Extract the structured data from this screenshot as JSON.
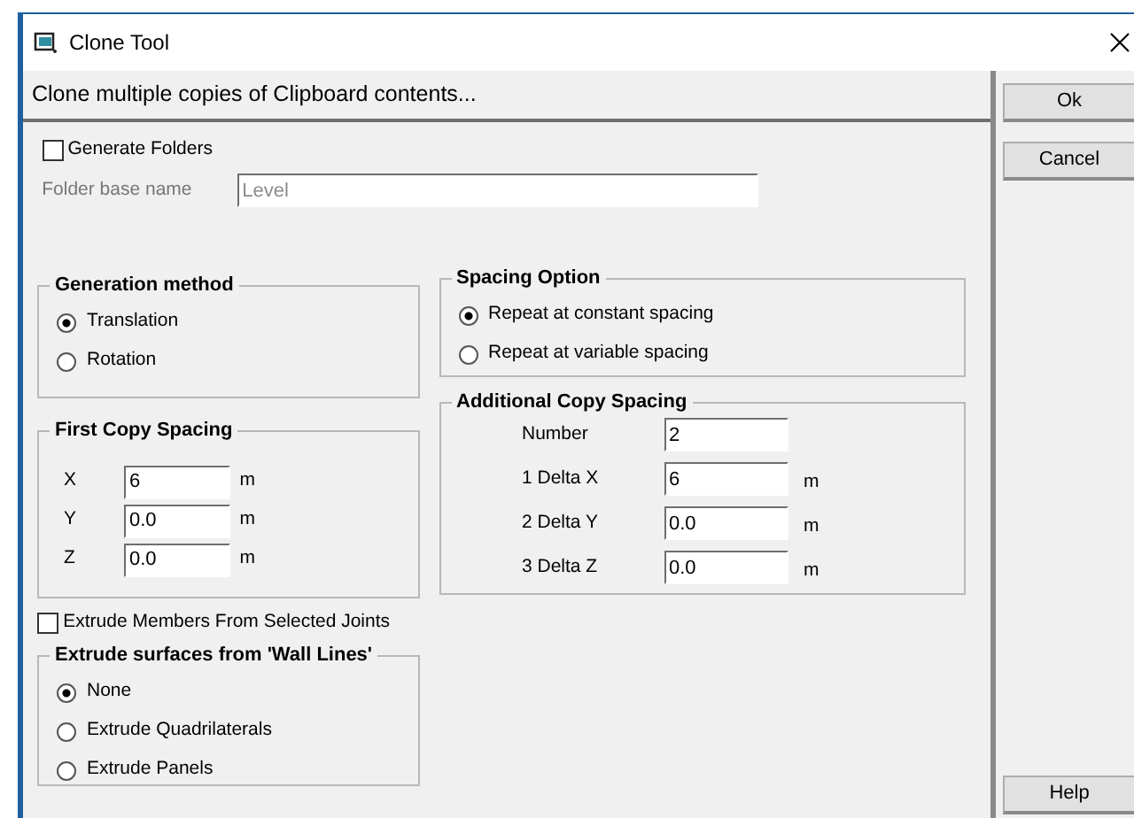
{
  "window": {
    "title": "Clone Tool"
  },
  "header": "Clone multiple copies of Clipboard contents...",
  "generate_folders": {
    "label": "Generate Folders",
    "checked": false
  },
  "folder_base_name": {
    "label": "Folder base name",
    "value": "Level",
    "disabled": true
  },
  "generation_method": {
    "title": "Generation method",
    "options": [
      {
        "label": "Translation",
        "selected": true
      },
      {
        "label": "Rotation",
        "selected": false
      }
    ]
  },
  "first_copy_spacing": {
    "title": "First Copy Spacing",
    "fields": [
      {
        "label": "X",
        "value": "6",
        "unit": "m"
      },
      {
        "label": "Y",
        "value": "0.0",
        "unit": "m"
      },
      {
        "label": "Z",
        "value": "0.0",
        "unit": "m"
      }
    ]
  },
  "spacing_option": {
    "title": "Spacing Option",
    "options": [
      {
        "label": "Repeat at constant spacing",
        "selected": true
      },
      {
        "label": "Repeat at variable spacing",
        "selected": false
      }
    ]
  },
  "additional_copy_spacing": {
    "title": "Additional Copy Spacing",
    "fields": [
      {
        "label": "Number",
        "value": "2"
      },
      {
        "label": "1 Delta X",
        "value": "6",
        "unit": "m"
      },
      {
        "label": "2 Delta Y",
        "value": "0.0",
        "unit": "m"
      },
      {
        "label": "3 Delta Z",
        "value": "0.0",
        "unit": "m"
      }
    ]
  },
  "extrude_members": {
    "label": "Extrude Members From Selected Joints",
    "checked": false
  },
  "extrude_surfaces": {
    "title": "Extrude surfaces from 'Wall Lines'",
    "options": [
      {
        "label": "None",
        "selected": true
      },
      {
        "label": "Extrude Quadrilaterals",
        "selected": false
      },
      {
        "label": "Extrude Panels",
        "selected": false
      }
    ]
  },
  "buttons": [
    {
      "label": "Ok"
    },
    {
      "label": "Cancel"
    }
  ],
  "help_button": {
    "label": "Help"
  }
}
